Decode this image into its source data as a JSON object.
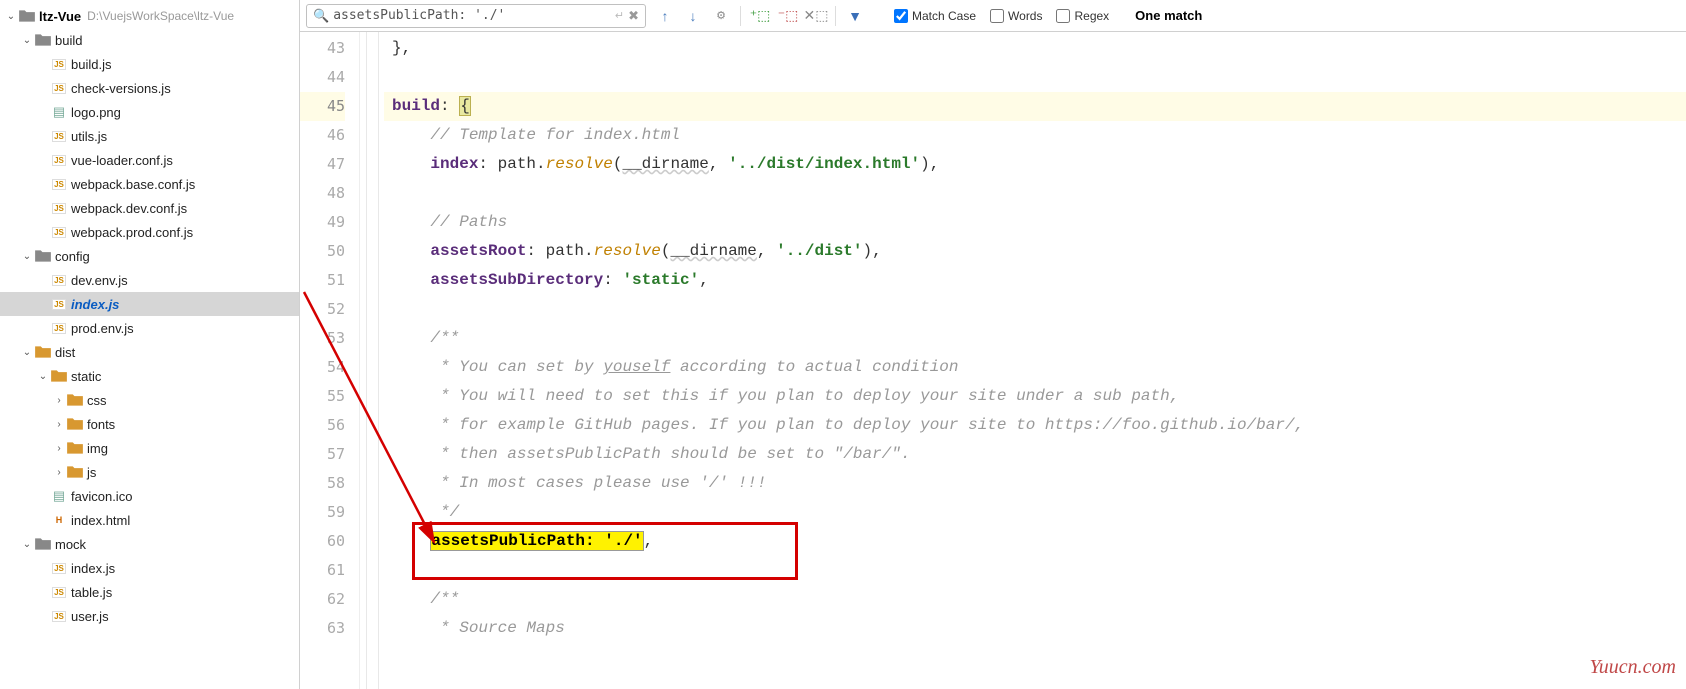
{
  "project": {
    "name": "ltz-Vue",
    "path": "D:\\VuejsWorkSpace\\ltz-Vue"
  },
  "tree": {
    "build": {
      "label": "build",
      "children": [
        "build.js",
        "check-versions.js",
        "logo.png",
        "utils.js",
        "vue-loader.conf.js",
        "webpack.base.conf.js",
        "webpack.dev.conf.js",
        "webpack.prod.conf.js"
      ]
    },
    "config": {
      "label": "config",
      "children": [
        "dev.env.js",
        "index.js",
        "prod.env.js"
      ]
    },
    "dist": {
      "label": "dist",
      "static": {
        "label": "static",
        "children": [
          "css",
          "fonts",
          "img",
          "js"
        ]
      },
      "files": [
        "favicon.ico",
        "index.html"
      ]
    },
    "mock": {
      "label": "mock",
      "children": [
        "index.js",
        "table.js",
        "user.js"
      ]
    }
  },
  "search": {
    "query": "assetsPublicPath: './'",
    "match_status": "One match",
    "opts": {
      "match_case": "Match Case",
      "words": "Words",
      "regex": "Regex"
    }
  },
  "code": {
    "lines": [
      {
        "n": 43,
        "html": "},"
      },
      {
        "n": 44,
        "html": ""
      },
      {
        "n": 45,
        "hi": true,
        "html": "<span class='prop'>build</span>: <span class='brace-hl'>{</span>"
      },
      {
        "n": 46,
        "html": "    <span class='com'>// Template for index.html</span>"
      },
      {
        "n": 47,
        "html": "    <span class='prop'>index</span>: <span class='id'>path</span>.<span class='fn'>resolve</span>(<span class='id under'>__dirname</span>, <span class='str'>'../dist/index.html'</span>),"
      },
      {
        "n": 48,
        "html": ""
      },
      {
        "n": 49,
        "html": "    <span class='com'>// Paths</span>"
      },
      {
        "n": 50,
        "html": "    <span class='prop'>assetsRoot</span>: <span class='id'>path</span>.<span class='fn'>resolve</span>(<span class='id under'>__dirname</span>, <span class='str'>'../dist'</span>),"
      },
      {
        "n": 51,
        "html": "    <span class='prop'>assetsSubDirectory</span>: <span class='str'>'static'</span>,"
      },
      {
        "n": 52,
        "html": ""
      },
      {
        "n": 53,
        "html": "    <span class='com'>/**</span>"
      },
      {
        "n": 54,
        "html": "    <span class='com'> * You can set by <u>youself</u> according to actual condition</span>"
      },
      {
        "n": 55,
        "html": "    <span class='com'> * You will need to set this if you plan to deploy your site under a sub path,</span>"
      },
      {
        "n": 56,
        "html": "    <span class='com'> * for example GitHub pages. If you plan to deploy your site to https://foo.github.io/bar/,</span>"
      },
      {
        "n": 57,
        "html": "    <span class='com'> * then assetsPublicPath should be set to \"/bar/\".</span>"
      },
      {
        "n": 58,
        "html": "    <span class='com'> * In most cases please use '/' !!!</span>"
      },
      {
        "n": 59,
        "html": "    <span class='com'> */</span>"
      },
      {
        "n": 60,
        "html": "    <span class='search-hit'><b>assetsPublicPath: './'</b></span>,"
      },
      {
        "n": 61,
        "html": ""
      },
      {
        "n": 62,
        "html": "    <span class='com'>/**</span>"
      },
      {
        "n": 63,
        "html": "    <span class='com'> * Source Maps</span>"
      }
    ]
  },
  "watermark": "Yuucn.com"
}
